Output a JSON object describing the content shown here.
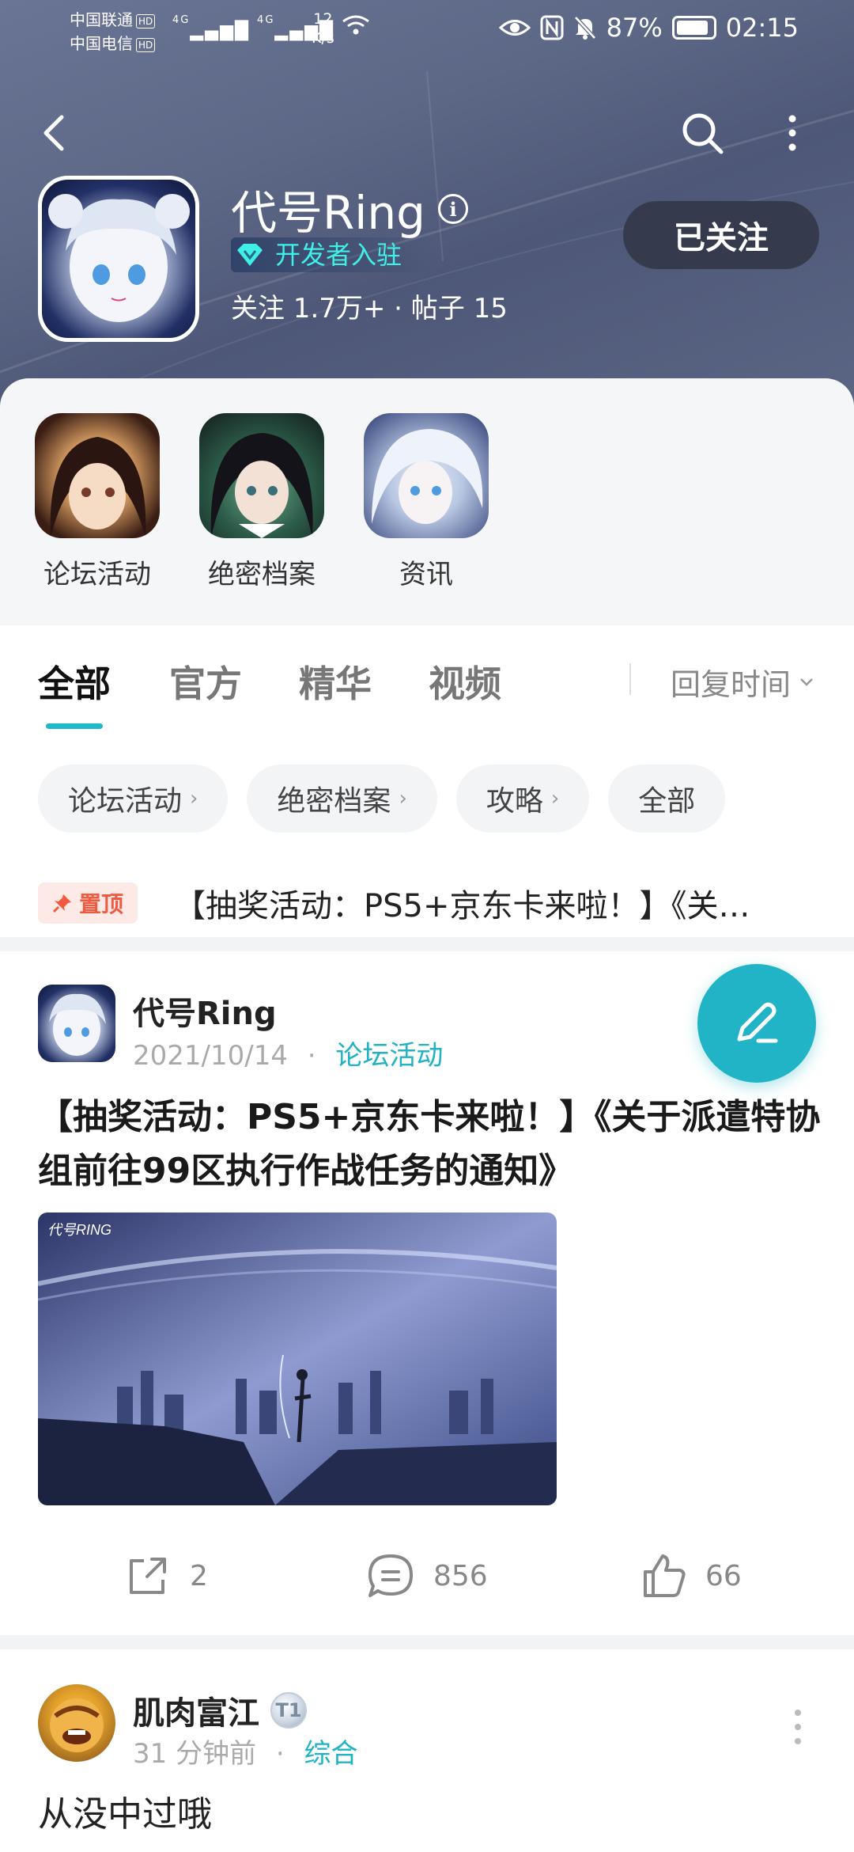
{
  "status_bar": {
    "carrier1": "中国联通",
    "carrier2": "中国电信",
    "hd": "HD",
    "net1": "4G",
    "net2": "4G",
    "speed_value": "12",
    "speed_unit": "K/s",
    "battery": "87%",
    "time": "02:15"
  },
  "header": {
    "game_title": "代号Ring",
    "developer_badge": "开发者入驻",
    "stats": "关注 1.7万+ · 帖子 15",
    "follow_label": "已关注"
  },
  "quick_links": [
    {
      "label": "论坛活动"
    },
    {
      "label": "绝密档案"
    },
    {
      "label": "资讯"
    }
  ],
  "tabs": [
    {
      "label": "全部",
      "active": true
    },
    {
      "label": "官方"
    },
    {
      "label": "精华"
    },
    {
      "label": "视频"
    }
  ],
  "sort_label": "回复时间",
  "chips": [
    {
      "label": "论坛活动"
    },
    {
      "label": "绝密档案"
    },
    {
      "label": "攻略"
    },
    {
      "label": "全部"
    }
  ],
  "pinned": {
    "badge": "置顶",
    "text": "【抽奖活动：PS5+京东卡来啦！】《关…"
  },
  "post": {
    "author": "代号Ring",
    "date": "2021/10/14",
    "category": "论坛活动",
    "title": "【抽奖活动：PS5+京东卡来啦！】《关于派遣特协组前往99区执行作战任务的通知》",
    "image_logo": "代号RING",
    "shares": "2",
    "comments": "856",
    "likes": "66"
  },
  "post2": {
    "author": "肌肉富江",
    "level": "T1",
    "time": "31 分钟前",
    "category": "综合",
    "content": "从没中过哦"
  },
  "colors": {
    "accent": "#20b4c6",
    "header_bg": "#5d6786",
    "pin_red": "#f05a40"
  }
}
